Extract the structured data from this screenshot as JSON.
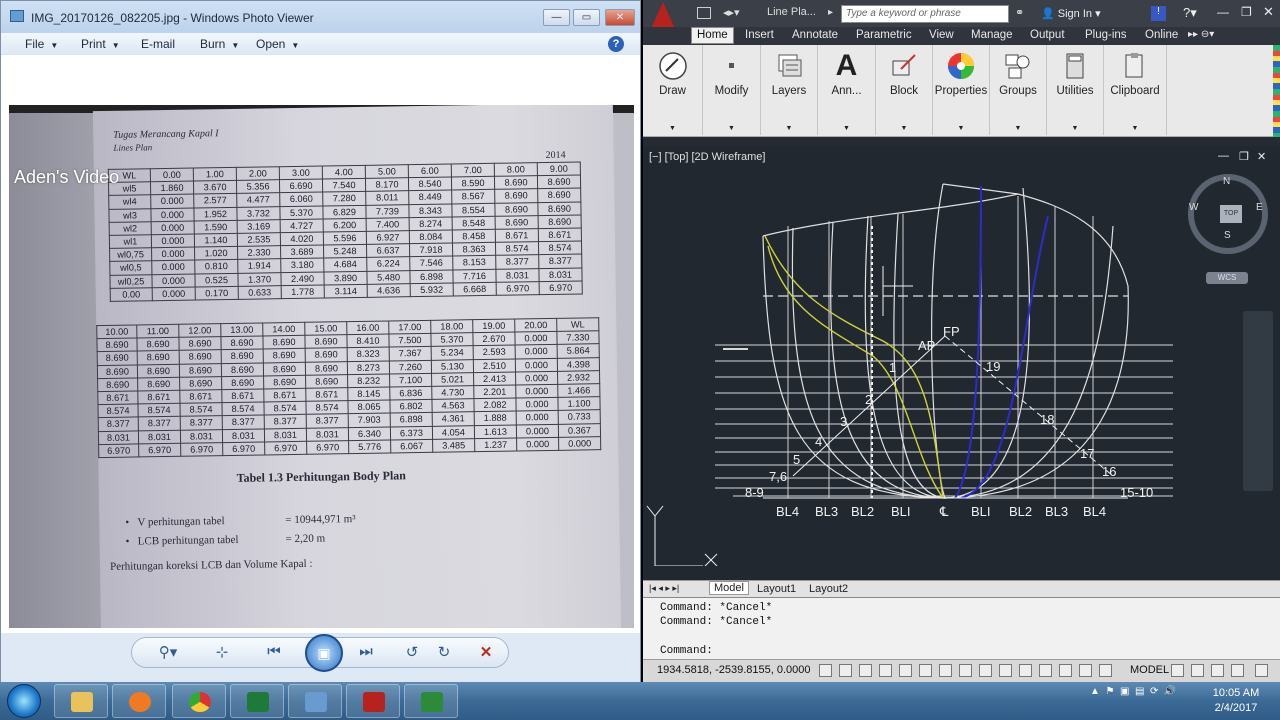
{
  "viewer": {
    "title": "IMG_20170126_082205.jpg - Windows Photo Viewer",
    "menu": [
      "File",
      "Print",
      "E-mail",
      "Burn",
      "Open"
    ],
    "help": "?",
    "watermark": "Aden's Video",
    "photo": {
      "header1": "Tugas Merancang Kapal I",
      "header2": "Lines Plan",
      "year": "2014",
      "table1": [
        [
          "WL",
          "0.00",
          "1.00",
          "2.00",
          "3.00",
          "4.00",
          "5.00",
          "6.00",
          "7.00",
          "8.00",
          "9.00"
        ],
        [
          "wl5",
          "1.860",
          "3.670",
          "5.356",
          "6.690",
          "7.540",
          "8.170",
          "8.540",
          "8.590",
          "8.690",
          "8.690"
        ],
        [
          "wl4",
          "0.000",
          "2.577",
          "4.477",
          "6.060",
          "7.280",
          "8.011",
          "8.449",
          "8.567",
          "8.690",
          "8.690"
        ],
        [
          "wl3",
          "0.000",
          "1.952",
          "3.732",
          "5.370",
          "6.829",
          "7.739",
          "8.343",
          "8.554",
          "8.690",
          "8.690"
        ],
        [
          "wl2",
          "0.000",
          "1.590",
          "3.169",
          "4.727",
          "6.200",
          "7.400",
          "8.274",
          "8.548",
          "8.690",
          "8.690"
        ],
        [
          "wl1",
          "0.000",
          "1.140",
          "2.535",
          "4.020",
          "5.596",
          "6.927",
          "8.084",
          "8.458",
          "8.671",
          "8.671"
        ],
        [
          "wl0,75",
          "0.000",
          "1.020",
          "2.330",
          "3.689",
          "5.248",
          "6.637",
          "7.918",
          "8.363",
          "8.574",
          "8.574"
        ],
        [
          "wl0,5",
          "0.000",
          "0.810",
          "1.914",
          "3.180",
          "4.684",
          "6.224",
          "7.546",
          "8.153",
          "8.377",
          "8.377"
        ],
        [
          "wl0,25",
          "0.000",
          "0.525",
          "1.370",
          "2.490",
          "3.890",
          "5.480",
          "6.898",
          "7.716",
          "8.031",
          "8.031"
        ],
        [
          "0.00",
          "0.000",
          "0.170",
          "0.633",
          "1.778",
          "3.114",
          "4.636",
          "5.932",
          "6.668",
          "6.970",
          "6.970"
        ]
      ],
      "table2": [
        [
          "10.00",
          "11.00",
          "12.00",
          "13.00",
          "14.00",
          "15.00",
          "16.00",
          "17.00",
          "18.00",
          "19.00",
          "20.00",
          "WL"
        ],
        [
          "8.690",
          "8.690",
          "8.690",
          "8.690",
          "8.690",
          "8.690",
          "8.410",
          "7.500",
          "5.370",
          "2.670",
          "0.000",
          "7.330"
        ],
        [
          "8.690",
          "8.690",
          "8.690",
          "8.690",
          "8.690",
          "8.690",
          "8.323",
          "7.367",
          "5.234",
          "2.593",
          "0.000",
          "5.864"
        ],
        [
          "8.690",
          "8.690",
          "8.690",
          "8.690",
          "8.690",
          "8.690",
          "8.273",
          "7.260",
          "5.130",
          "2.510",
          "0.000",
          "4.398"
        ],
        [
          "8.690",
          "8.690",
          "8.690",
          "8.690",
          "8.690",
          "8.690",
          "8.232",
          "7.100",
          "5.021",
          "2.413",
          "0.000",
          "2.932"
        ],
        [
          "8.671",
          "8.671",
          "8.671",
          "8.671",
          "8.671",
          "8.671",
          "8.145",
          "6.836",
          "4.730",
          "2.201",
          "0.000",
          "1.466"
        ],
        [
          "8.574",
          "8.574",
          "8.574",
          "8.574",
          "8.574",
          "8.574",
          "8.065",
          "6.802",
          "4.563",
          "2.082",
          "0.000",
          "1.100"
        ],
        [
          "8.377",
          "8.377",
          "8.377",
          "8.377",
          "8.377",
          "8.377",
          "7.903",
          "6.898",
          "4.361",
          "1.888",
          "0.000",
          "0.733"
        ],
        [
          "8.031",
          "8.031",
          "8.031",
          "8.031",
          "8.031",
          "8.031",
          "6.340",
          "6.373",
          "4.054",
          "1.613",
          "0.000",
          "0.367"
        ],
        [
          "6.970",
          "6.970",
          "6.970",
          "6.970",
          "6.970",
          "6.970",
          "5.776",
          "6.067",
          "3.485",
          "1.237",
          "0.000",
          "0.000"
        ]
      ],
      "caption": "Tabel 1.3 Perhitungan Body Plan",
      "bullet1_label": "V perhitungan tabel",
      "bullet1_value": "= 10944,971 m³",
      "bullet2_label": "LCB perhitungan tabel",
      "bullet2_value": "= 2,20 m",
      "footer": "Perhitungan koreksi LCB dan Volume Kapal :"
    }
  },
  "autocad": {
    "title": "Line Pla...",
    "search_placeholder": "Type a keyword or phrase",
    "signin": "Sign In",
    "tabs": [
      "Home",
      "Insert",
      "Annotate",
      "Parametric",
      "View",
      "Manage",
      "Output",
      "Plug-ins",
      "Online"
    ],
    "panels": [
      "Draw",
      "Modify",
      "Layers",
      "Ann...",
      "Block",
      "Properties",
      "Groups",
      "Utilities",
      "Clipboard"
    ],
    "viewport_label": "[−] [Top] [2D Wireframe]",
    "compass": {
      "n": "N",
      "s": "S",
      "e": "E",
      "w": "W",
      "top": "TOP"
    },
    "wcs": "WCS",
    "drawing_labels": {
      "fp": "FP",
      "ap": "AP",
      "stations_left": [
        "1",
        "2",
        "3",
        "4",
        "5",
        "7,6",
        "8-9"
      ],
      "stations_right": [
        "19",
        "18",
        "17",
        "16",
        "15-10"
      ],
      "bottom": [
        "BL4",
        "BL3",
        "BL2",
        "BLI",
        "℄",
        "BLI",
        "BL2",
        "BL3",
        "BL4"
      ]
    },
    "layout_tabs": [
      "Model",
      "Layout1",
      "Layout2"
    ],
    "command_history": [
      "Command: *Cancel*",
      "Command: *Cancel*"
    ],
    "command_prompt": "Command:",
    "coords": "1934.5818, -2539.8155, 0.0000",
    "model_label": "MODEL"
  },
  "taskbar": {
    "time": "10:05 AM",
    "date": "2/4/2017"
  }
}
